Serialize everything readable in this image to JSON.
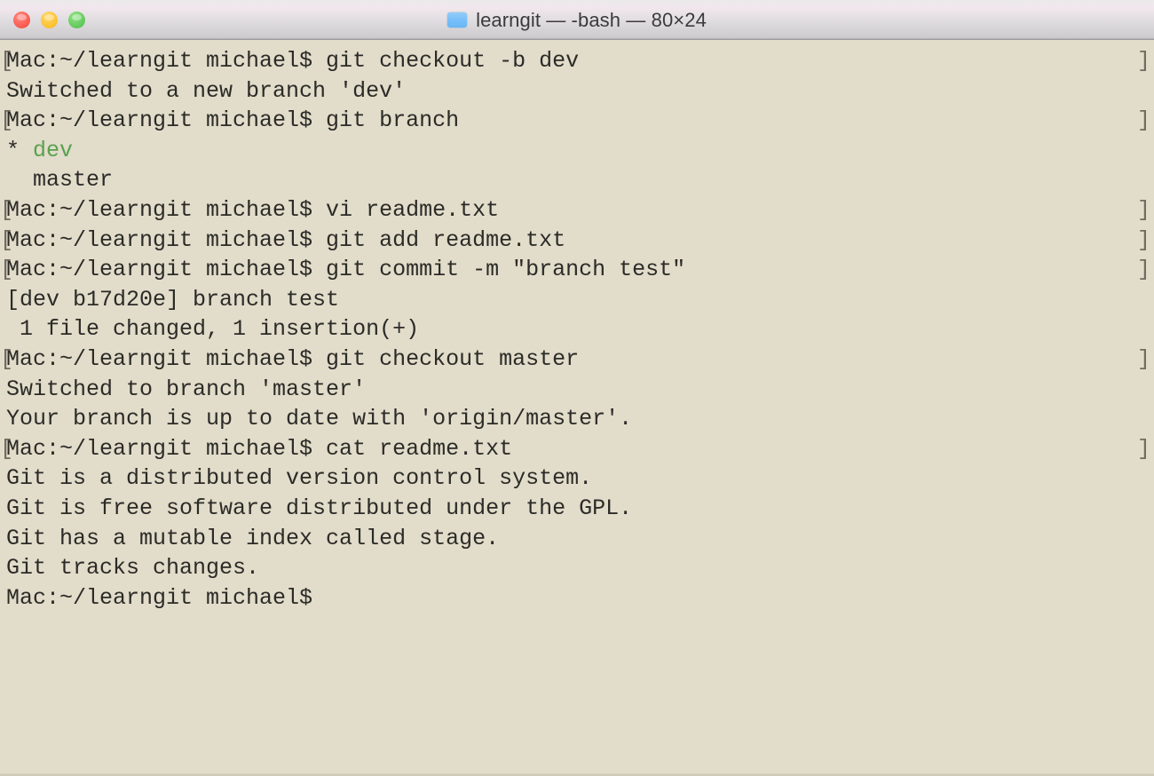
{
  "window": {
    "title": "learngit — -bash — 80×24",
    "folder_icon": "folder-icon",
    "traffic_lights": [
      {
        "name": "close-button",
        "label": "Close",
        "color": "#f9564c"
      },
      {
        "name": "minimize-button",
        "label": "Minimize",
        "color": "#fbc02d"
      },
      {
        "name": "maximize-button",
        "label": "Maximize",
        "color": "#5ec75a"
      }
    ]
  },
  "terminal": {
    "background_color": "#e2dcca",
    "text_color": "#2b2b27",
    "green_color": "#59a14f",
    "columns": 80,
    "rows": 24,
    "prompt": "Mac:~/learngit michael$",
    "wrap_marker_left": "[",
    "wrap_marker_right": "]",
    "lines": [
      {
        "text": "Mac:~/learngit michael$ git checkout -b dev",
        "marker_left": true,
        "marker_right": true,
        "color": "default"
      },
      {
        "text": "Switched to a new branch 'dev'",
        "marker_left": false,
        "marker_right": false,
        "color": "default"
      },
      {
        "text": "Mac:~/learngit michael$ git branch",
        "marker_left": true,
        "marker_right": true,
        "color": "default"
      },
      {
        "text": "* dev",
        "marker_left": false,
        "marker_right": false,
        "color": "green"
      },
      {
        "text": "  master",
        "marker_left": false,
        "marker_right": false,
        "color": "default"
      },
      {
        "text": "Mac:~/learngit michael$ vi readme.txt",
        "marker_left": true,
        "marker_right": true,
        "color": "default"
      },
      {
        "text": "Mac:~/learngit michael$ git add readme.txt",
        "marker_left": true,
        "marker_right": true,
        "color": "default"
      },
      {
        "text": "Mac:~/learngit michael$ git commit -m \"branch test\"",
        "marker_left": true,
        "marker_right": true,
        "color": "default"
      },
      {
        "text": "[dev b17d20e] branch test",
        "marker_left": false,
        "marker_right": false,
        "color": "default"
      },
      {
        "text": " 1 file changed, 1 insertion(+)",
        "marker_left": false,
        "marker_right": false,
        "color": "default"
      },
      {
        "text": "Mac:~/learngit michael$ git checkout master",
        "marker_left": true,
        "marker_right": true,
        "color": "default"
      },
      {
        "text": "Switched to branch 'master'",
        "marker_left": false,
        "marker_right": false,
        "color": "default"
      },
      {
        "text": "Your branch is up to date with 'origin/master'.",
        "marker_left": false,
        "marker_right": false,
        "color": "default"
      },
      {
        "text": "Mac:~/learngit michael$ cat readme.txt",
        "marker_left": true,
        "marker_right": true,
        "color": "default"
      },
      {
        "text": "Git is a distributed version control system.",
        "marker_left": false,
        "marker_right": false,
        "color": "default"
      },
      {
        "text": "Git is free software distributed under the GPL.",
        "marker_left": false,
        "marker_right": false,
        "color": "default"
      },
      {
        "text": "Git has a mutable index called stage.",
        "marker_left": false,
        "marker_right": false,
        "color": "default"
      },
      {
        "text": "Git tracks changes.",
        "marker_left": false,
        "marker_right": false,
        "color": "default"
      },
      {
        "text": "Mac:~/learngit michael$",
        "marker_left": false,
        "marker_right": false,
        "color": "default"
      }
    ]
  }
}
